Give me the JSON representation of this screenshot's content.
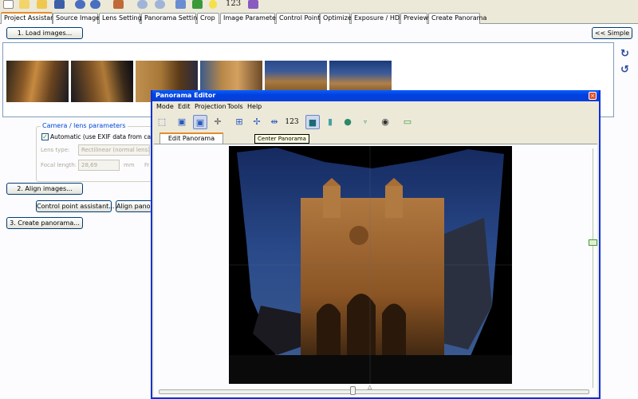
{
  "toolbar": {
    "number_label": "123",
    "icons": [
      "new-file-icon",
      "open-folder-icon",
      "add-images-icon",
      "save-icon",
      "undo-icon",
      "redo-icon",
      "control-points-icon",
      "zoom-in-icon",
      "zoom-out-icon",
      "copy-icon",
      "table-icon",
      "lightbulb-icon",
      "number-icon",
      "book-icon"
    ]
  },
  "tabs": [
    {
      "label": "Project Assistant",
      "active": true
    },
    {
      "label": "Source Images"
    },
    {
      "label": "Lens Settings"
    },
    {
      "label": "Panorama Settings"
    },
    {
      "label": "Crop"
    },
    {
      "label": "Image Parameters"
    },
    {
      "label": "Control Points"
    },
    {
      "label": "Optimizer"
    },
    {
      "label": "Exposure / HDR"
    },
    {
      "label": "Preview"
    },
    {
      "label": "Create Panorama"
    }
  ],
  "assistant": {
    "load_button": "1. Load images...",
    "simple_button": "<< Simple",
    "align_button": "2. Align images...",
    "cp_assistant_button": "Control point assistant...",
    "align_panorama_button": "Align panor",
    "create_button": "3. Create panorama...",
    "camera": {
      "group_title": "Camera / lens parameters",
      "auto_checkbox_label": "Automatic (use EXIF data from camera)",
      "auto_checked": true,
      "lens_type_label": "Lens type:",
      "lens_type_value": "Rectilinear (normal lens)",
      "focal_length_label": "Focal length:",
      "focal_length_value": "28,69",
      "focal_unit": "mm",
      "crop_label_partial": "Fr"
    }
  },
  "editor": {
    "title": "Panorama Editor",
    "close_glyph": "×",
    "menus": [
      "Mode",
      "Edit",
      "Projection",
      "Tools",
      "Help"
    ],
    "tool_number": "123",
    "tooltip": "Center Panorama",
    "tab": "Edit Panorama",
    "colors": {
      "titlebar": "#0a5fff",
      "active_tab_accent": "#e68b2c"
    }
  }
}
